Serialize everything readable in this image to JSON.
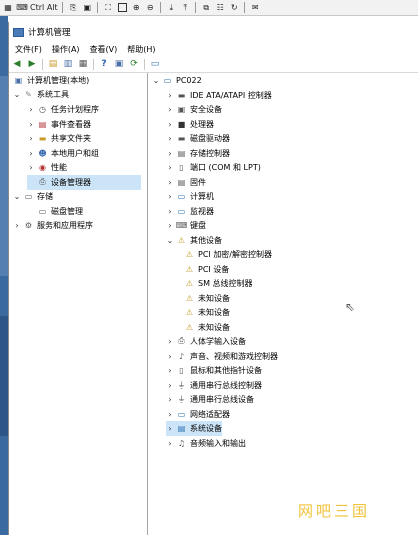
{
  "window": {
    "title": "计算机管理"
  },
  "menu": [
    "文件(F)",
    "操作(A)",
    "查看(V)",
    "帮助(H)"
  ],
  "outer_toolbar": {
    "ctrl_label": "Ctrl",
    "alt_label": "Alt"
  },
  "left_tree": {
    "root": "计算机管理(本地)",
    "system_tools": "系统工具",
    "task_scheduler": "任务计划程序",
    "event_viewer": "事件查看器",
    "shared_folders": "共享文件夹",
    "local_users": "本地用户和组",
    "performance": "性能",
    "device_manager": "设备管理器",
    "storage": "存储",
    "disk_management": "磁盘管理",
    "services_apps": "服务和应用程序"
  },
  "right_tree": {
    "computer_name": "PC022",
    "categories": [
      "IDE ATA/ATAPI 控制器",
      "安全设备",
      "处理器",
      "磁盘驱动器",
      "存储控制器",
      "端口 (COM 和 LPT)",
      "固件",
      "计算机",
      "监视器",
      "键盘",
      "其他设备"
    ],
    "other_devices": [
      "PCI 加密/解密控制器",
      "PCI 设备",
      "SM 总线控制器",
      "未知设备",
      "未知设备",
      "未知设备"
    ],
    "categories_after": [
      "人体学输入设备",
      "声音、视频和游戏控制器",
      "鼠标和其他指针设备",
      "通用串行总线控制器",
      "通用串行总线设备",
      "网络适配器",
      "系统设备",
      "音频输入和输出"
    ]
  },
  "watermark": "网吧三国"
}
